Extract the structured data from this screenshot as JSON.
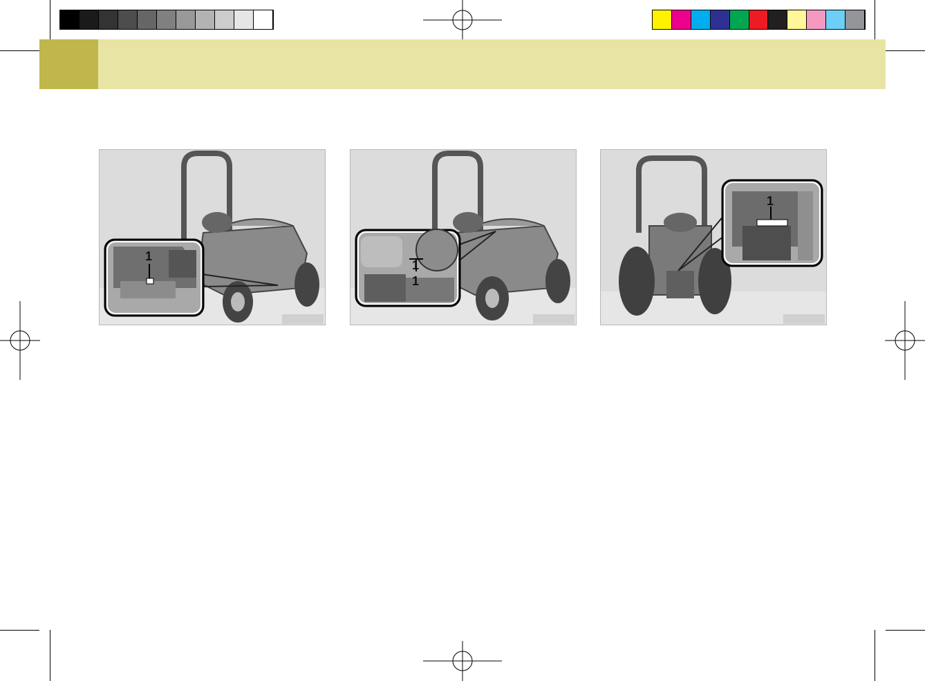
{
  "header": {
    "title": ""
  },
  "colors": {
    "band": "#e8e4a3",
    "band_tab": "#bfb74b",
    "grayscale_swatches": [
      "#000000",
      "#1a1a1a",
      "#333333",
      "#4d4d4d",
      "#666666",
      "#808080",
      "#999999",
      "#b3b3b3",
      "#cccccc",
      "#e6e6e6",
      "#ffffff"
    ],
    "color_swatches": [
      "#fff200",
      "#ec008c",
      "#00aeef",
      "#2e3192",
      "#00a651",
      "#ed1c24",
      "#231f20",
      "#fff799",
      "#f49ac1",
      "#6dcff6",
      "#939598"
    ]
  },
  "figures": [
    {
      "callout_number": "1",
      "figure_id": ""
    },
    {
      "callout_number": "1",
      "callout_number_b": "1",
      "figure_id": ""
    },
    {
      "callout_number": "1",
      "figure_id": ""
    }
  ]
}
